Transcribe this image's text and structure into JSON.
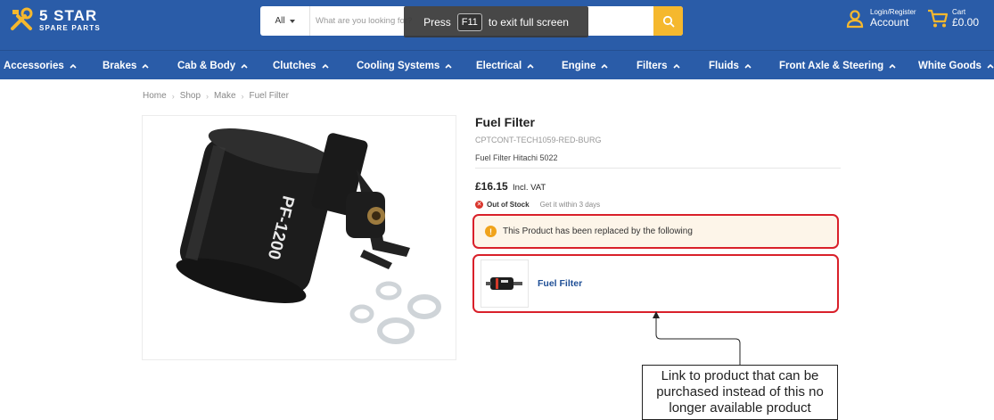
{
  "header": {
    "logo": {
      "title": "5 STAR",
      "subtitle": "SPARE PARTS"
    },
    "search": {
      "category": "All",
      "placeholder": "What are you looking for?"
    },
    "fullscreen_notice": {
      "before": "Press",
      "key": "F11",
      "after": "to exit full screen"
    },
    "account": {
      "small": "Login/Register",
      "label": "Account"
    },
    "cart": {
      "small": "Cart",
      "total": "£0.00"
    },
    "colors": {
      "bar": "#2a5ca8",
      "search_button": "#f5b82e"
    }
  },
  "nav": {
    "items": [
      {
        "label": "Accessories"
      },
      {
        "label": "Brakes"
      },
      {
        "label": "Cab & Body"
      },
      {
        "label": "Clutches"
      },
      {
        "label": "Cooling Systems"
      },
      {
        "label": "Electrical"
      },
      {
        "label": "Engine"
      },
      {
        "label": "Filters"
      },
      {
        "label": "Fluids"
      },
      {
        "label": "Front Axle & Steering"
      },
      {
        "label": "White Goods"
      }
    ]
  },
  "breadcrumb": [
    "Home",
    "Shop",
    "Make",
    "Fuel Filter"
  ],
  "product": {
    "title": "Fuel Filter",
    "sku": "CPTCONT-TECH1059-RED-BURG",
    "description": "Fuel Filter Hitachi 5022",
    "price": "£16.15",
    "vat_label": "Incl. VAT",
    "stock_status": "Out of Stock",
    "eta": "Get it within 3 days",
    "image_label": "PF-1200"
  },
  "replacement": {
    "notice": "This Product has been replaced by the following",
    "item_label": "Fuel Filter"
  },
  "annotation": {
    "line1": "Link to product that can be",
    "line2": "purchased instead of this no",
    "line3": "longer available product"
  }
}
